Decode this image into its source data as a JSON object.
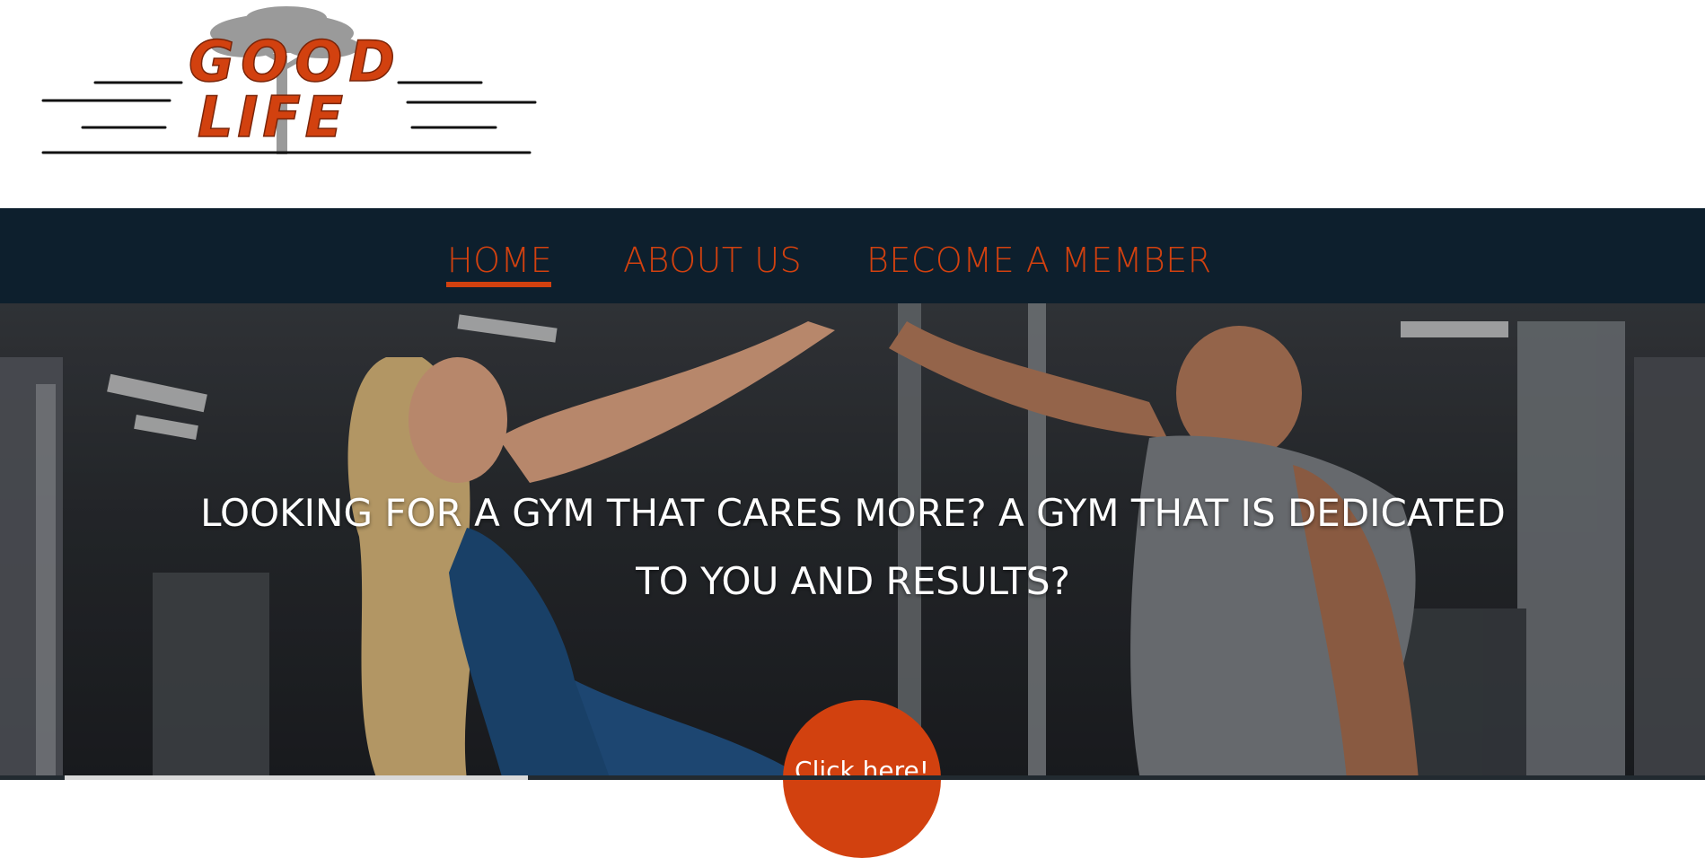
{
  "logo": {
    "line1": "GOOD",
    "line2": "LIFE",
    "brand_color": "#d2410f",
    "icon": "tree-icon"
  },
  "nav": {
    "items": [
      {
        "label": "HOME",
        "active": true
      },
      {
        "label": "ABOUT US",
        "active": false
      },
      {
        "label": "BECOME A MEMBER",
        "active": false
      }
    ],
    "background": "#0d1f2d",
    "accent": "#d2410f"
  },
  "hero": {
    "headline_line1": "LOOKING FOR A GYM THAT CARES MORE? A GYM THAT IS DEDICATED",
    "headline_line2": "TO YOU AND RESULTS?",
    "cta_label": "Click here!"
  }
}
